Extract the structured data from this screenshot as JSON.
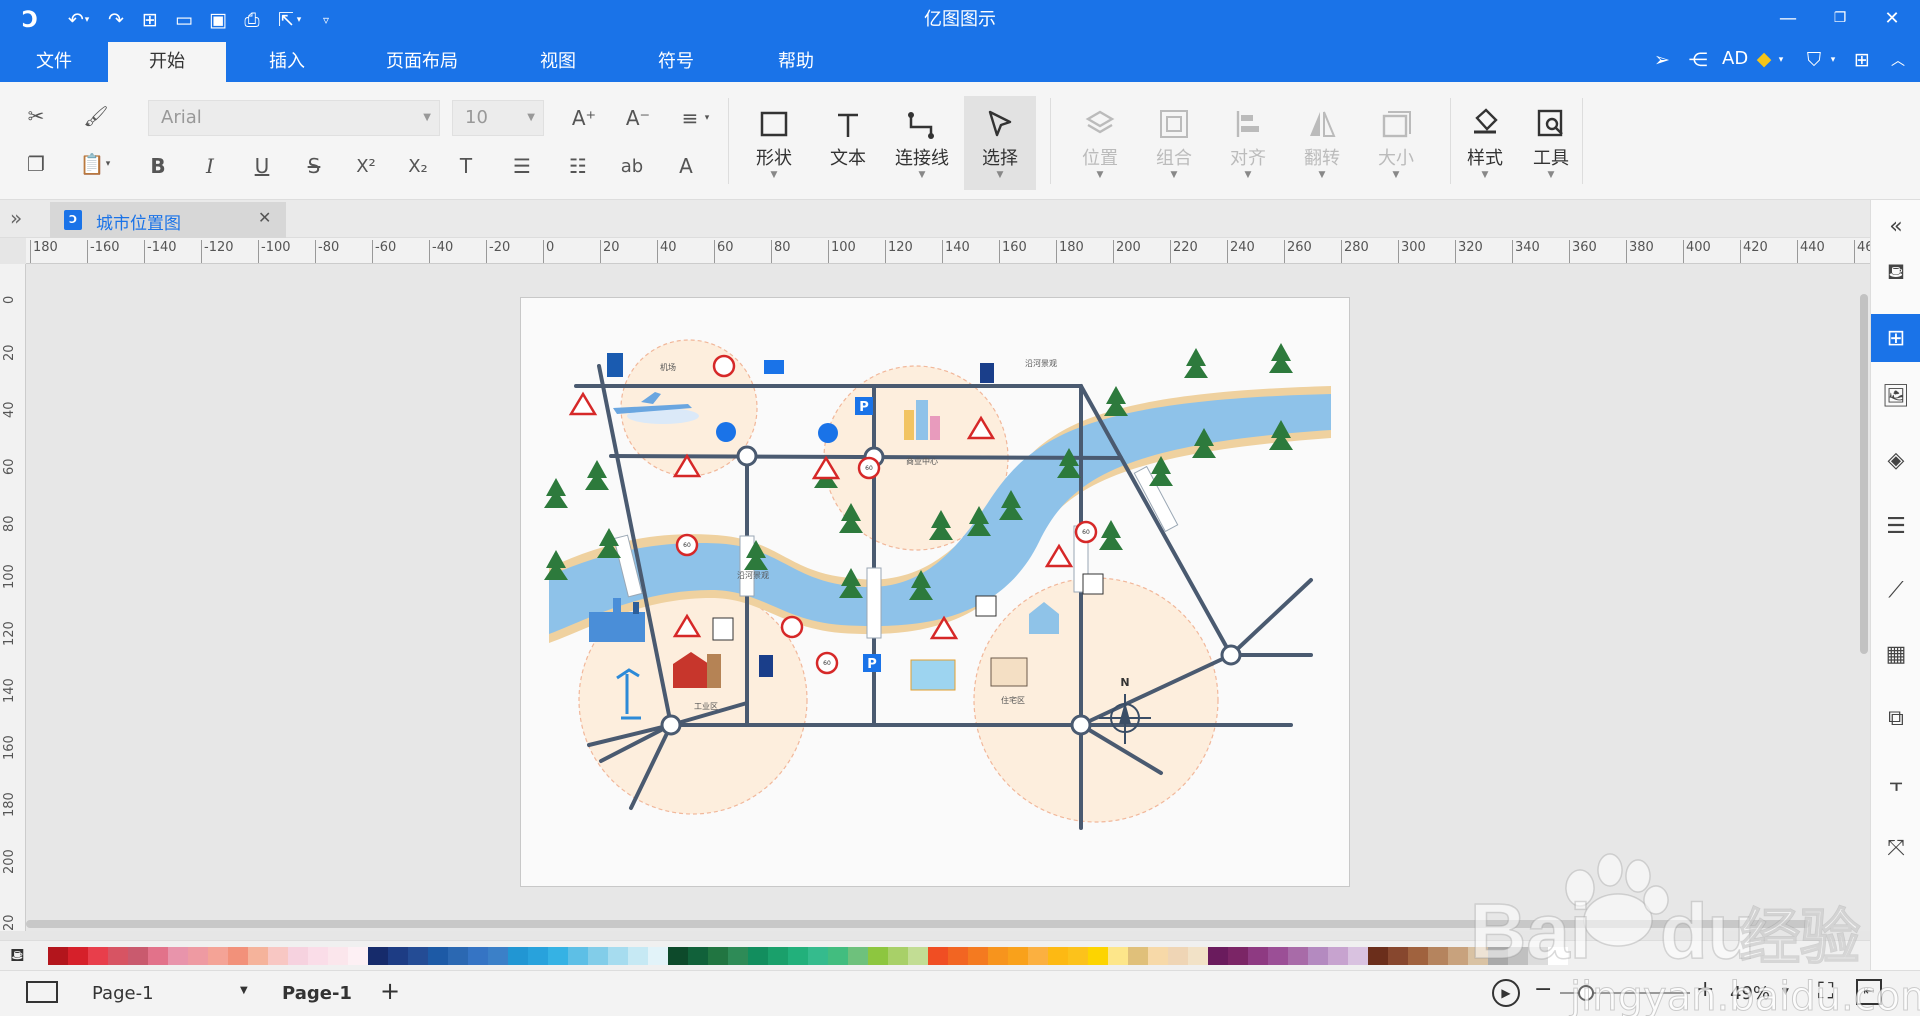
{
  "app": {
    "title": "亿图图示",
    "user": "AD"
  },
  "menu": {
    "tabs": [
      "文件",
      "开始",
      "插入",
      "页面布局",
      "视图",
      "符号",
      "帮助"
    ],
    "active": 1
  },
  "toolbar": {
    "font_name": "Arial",
    "font_size": "10",
    "text_style_glyphs": {
      "bold": "B",
      "italic": "I",
      "underline": "U",
      "strike": "S",
      "superscript": "X²",
      "subscript": "X₂",
      "text": "T",
      "case": "ab",
      "font_color": "A",
      "grow": "A⁺",
      "shrink": "A⁻"
    },
    "tools": [
      {
        "label": "形状",
        "icon": "rectangle-icon"
      },
      {
        "label": "文本",
        "icon": "text-icon"
      },
      {
        "label": "连接线",
        "icon": "connector-icon"
      },
      {
        "label": "选择",
        "icon": "pointer-icon"
      }
    ],
    "arrange": [
      {
        "label": "位置",
        "icon": "layers-icon"
      },
      {
        "label": "组合",
        "icon": "group-icon"
      },
      {
        "label": "对齐",
        "icon": "align-icon"
      },
      {
        "label": "翻转",
        "icon": "flip-icon"
      },
      {
        "label": "大小",
        "icon": "resize-icon"
      }
    ],
    "style_label": "样式",
    "tools_label": "工具"
  },
  "document": {
    "tab_title": "城市位置图"
  },
  "ruler": {
    "h_ticks": [
      "180",
      "-160",
      "-140",
      "-120",
      "-100",
      "-80",
      "-60",
      "-40",
      "-20",
      "0",
      "20",
      "40",
      "60",
      "80",
      "100",
      "120",
      "140",
      "160",
      "180",
      "200",
      "220",
      "240",
      "260",
      "280",
      "300",
      "320",
      "340",
      "360",
      "380",
      "400",
      "420",
      "440",
      "460"
    ],
    "v_ticks": [
      "0",
      "20",
      "40",
      "60",
      "80",
      "100",
      "120",
      "140",
      "160",
      "180",
      "200",
      "20"
    ]
  },
  "map": {
    "labels": {
      "airport": "机场",
      "riverside1": "沿河景观",
      "commercial": "商业中心",
      "riverside2": "沿河景观",
      "industrial": "工业区",
      "residential": "住宅区",
      "north": "N",
      "speed": "60",
      "parking": "P"
    }
  },
  "palette": [
    "#b3151c",
    "#d6202a",
    "#e83e4b",
    "#d75463",
    "#c95a6e",
    "#e2728a",
    "#e894ab",
    "#ee9aa2",
    "#f4a396",
    "#f2917a",
    "#f5b39b",
    "#f8c7c3",
    "#f6d2df",
    "#fadde8",
    "#fbe6ec",
    "#fdf0f4",
    "#162b6b",
    "#1d3c84",
    "#244c95",
    "#1d5aa6",
    "#2b68b2",
    "#3574c4",
    "#3b80c8",
    "#2196d3",
    "#28a2dc",
    "#35b2e4",
    "#5dbfe6",
    "#82cde9",
    "#a6dcef",
    "#c6e9f4",
    "#e2f3f9",
    "#0d4a2b",
    "#11613a",
    "#217541",
    "#2e8b57",
    "#128e5e",
    "#1aa06b",
    "#22b07b",
    "#35bb8d",
    "#42bd7f",
    "#6ec17c",
    "#8dc63f",
    "#a8d068",
    "#c2dd94",
    "#f04e23",
    "#f26522",
    "#f47a20",
    "#f7941d",
    "#f9a11b",
    "#fbb040",
    "#fdb913",
    "#fcc21b",
    "#fdd400",
    "#fde68a",
    "#e0c07a",
    "#f7d9a8",
    "#efd5b5",
    "#f2e2c7",
    "#6a1b5d",
    "#7b2566",
    "#8e3a82",
    "#9b4f96",
    "#a86ba8",
    "#b48ac0",
    "#c7a3cf",
    "#d9c2e0",
    "#6b2e1b",
    "#87472e",
    "#a0623e",
    "#b5845e",
    "#c8a27d",
    "#d9c2a3",
    "#a9a9a9",
    "#c0c0c0",
    "#dcdcdc",
    "#ffffff"
  ],
  "status": {
    "page_selector": "Page-1",
    "page_tab": "Page-1",
    "zoom": "49%",
    "add": "+"
  }
}
